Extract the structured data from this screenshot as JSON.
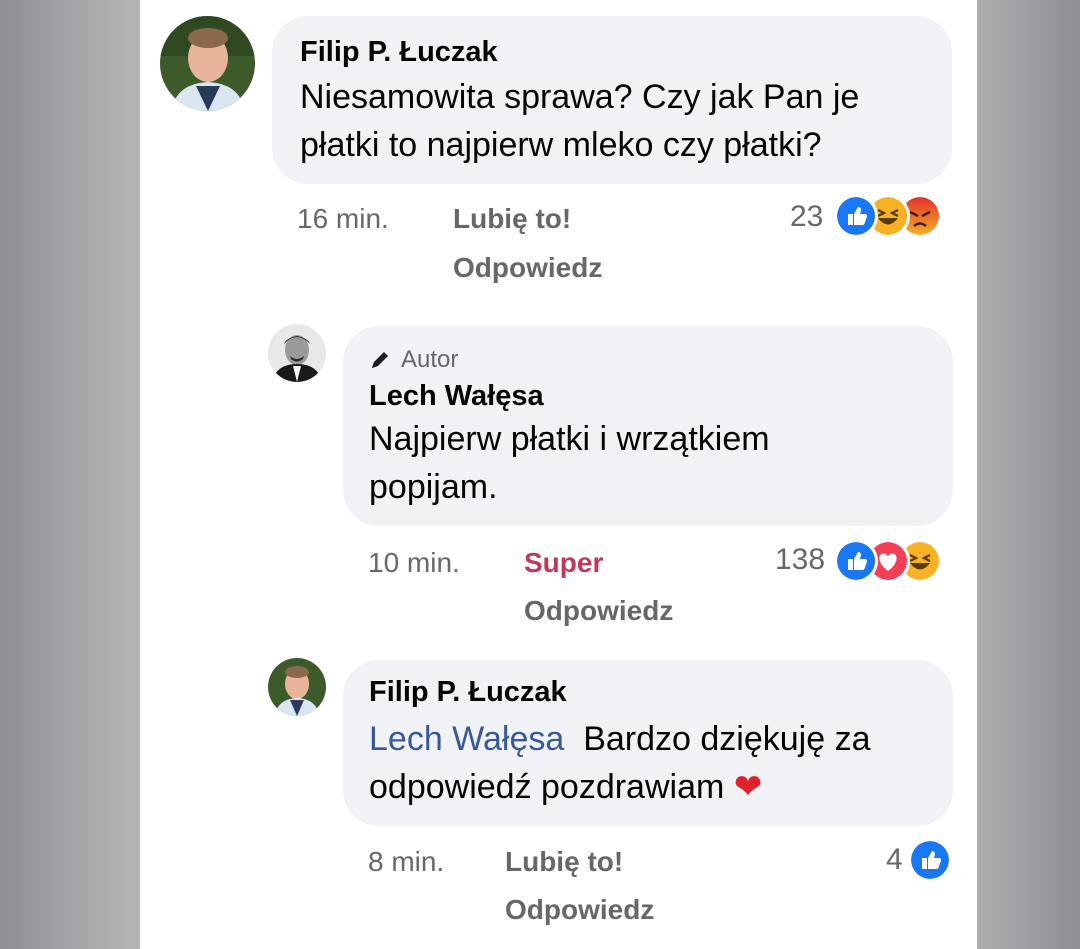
{
  "comments": [
    {
      "author": "Filip P. Łuczak",
      "text": "Niesamowita sprawa? Czy jak Pan je płatki to najpierw mleko czy płatki?",
      "time": "16 min.",
      "reaction_label": "Lubię to!",
      "reply_label": "Odpowiedz",
      "reaction_count": "23",
      "reactions": [
        "like-icon",
        "haha-icon",
        "angry-icon"
      ]
    },
    {
      "author_badge": "Autor",
      "author": "Lech Wałęsa",
      "text": "Najpierw płatki i wrzątkiem popijam.",
      "time": "10 min.",
      "reaction_label": "Super",
      "reply_label": "Odpowiedz",
      "reaction_count": "138",
      "reactions": [
        "like-icon",
        "love-icon",
        "haha-icon"
      ]
    },
    {
      "author": "Filip P. Łuczak",
      "mention": "Lech Wałęsa",
      "text": "Bardzo dziękuję za odpowiedź pozdrawiam",
      "emoji": "❤️",
      "time": "8 min.",
      "reaction_label": "Lubię to!",
      "reply_label": "Odpowiedz",
      "reaction_count": "4",
      "reactions": [
        "like-icon"
      ]
    }
  ],
  "colors": {
    "like": "#1877f2",
    "love": "#f33e58",
    "haha": "#f7b125",
    "angry": "#e9710f",
    "super_text": "#c0395a",
    "mention": "#385898"
  }
}
